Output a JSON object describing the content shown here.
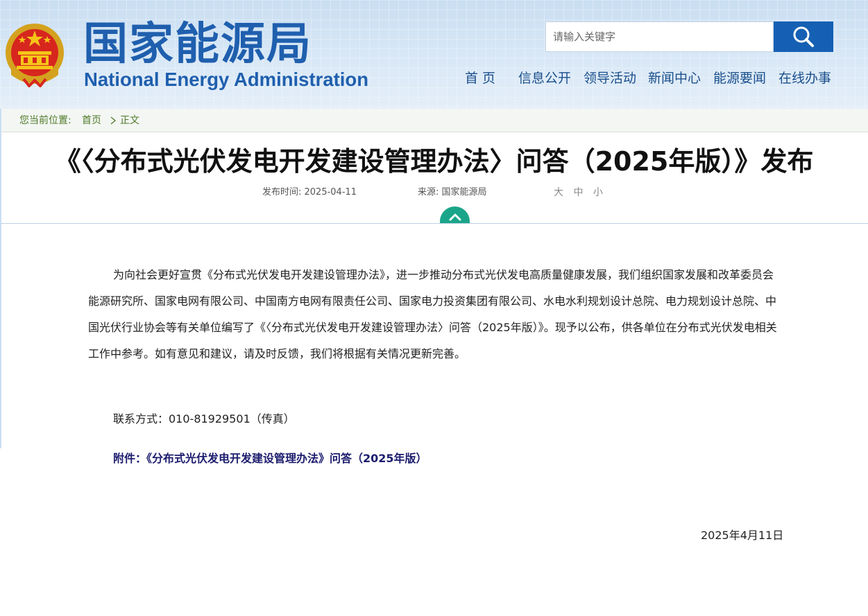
{
  "header": {
    "logo_cn": "国家能源局",
    "logo_en": "National Energy Administration",
    "search_placeholder": "请输入关键字",
    "nav": [
      {
        "label": "首 页"
      },
      {
        "label": "信息公开"
      },
      {
        "label": "领导活动"
      },
      {
        "label": "新闻中心"
      },
      {
        "label": "能源要闻"
      },
      {
        "label": "在线办事"
      }
    ]
  },
  "breadcrumb": {
    "prefix": "您当前位置:",
    "home": "首页",
    "current": "正文"
  },
  "article": {
    "title": "《〈分布式光伏发电开发建设管理办法〉问答（2025年版）》发布",
    "publish_time": "发布时间: 2025-04-11",
    "source": "来源: 国家能源局",
    "font_sizes": [
      "大",
      "中",
      "小"
    ],
    "body": "为向社会更好宣贯《分布式光伏发电开发建设管理办法》，进一步推动分布式光伏发电高质量健康发展，我们组织国家发展和改革委员会能源研究所、国家电网有限公司、中国南方电网有限责任公司、国家电力投资集团有限公司、水电水利规划设计总院、电力规划设计总院、中国光伏行业协会等有关单位编写了《〈分布式光伏发电开发建设管理办法〉问答（2025年版）》。现予以公布，供各单位在分布式光伏发电相关工作中参考。如有意见和建议，请及时反馈，我们将根据有关情况更新完善。",
    "contact": "联系方式：010-81929501（传真）",
    "attachment": "附件：《分布式光伏发电开发建设管理办法》问答（2025年版）",
    "sign_date": "2025年4月11日"
  },
  "colors": {
    "brand_blue": "#1f5fae",
    "search_button": "#1560b4",
    "scroll_button": "#1aa58a",
    "breadcrumb_green": "#4f7a28",
    "attachment_link": "#1c1c6e"
  },
  "icons": {
    "emblem": "national-emblem-icon",
    "search": "search-icon",
    "breadcrumb_separator": "chevron-right-icon",
    "scroll_top": "chevron-up-icon"
  }
}
